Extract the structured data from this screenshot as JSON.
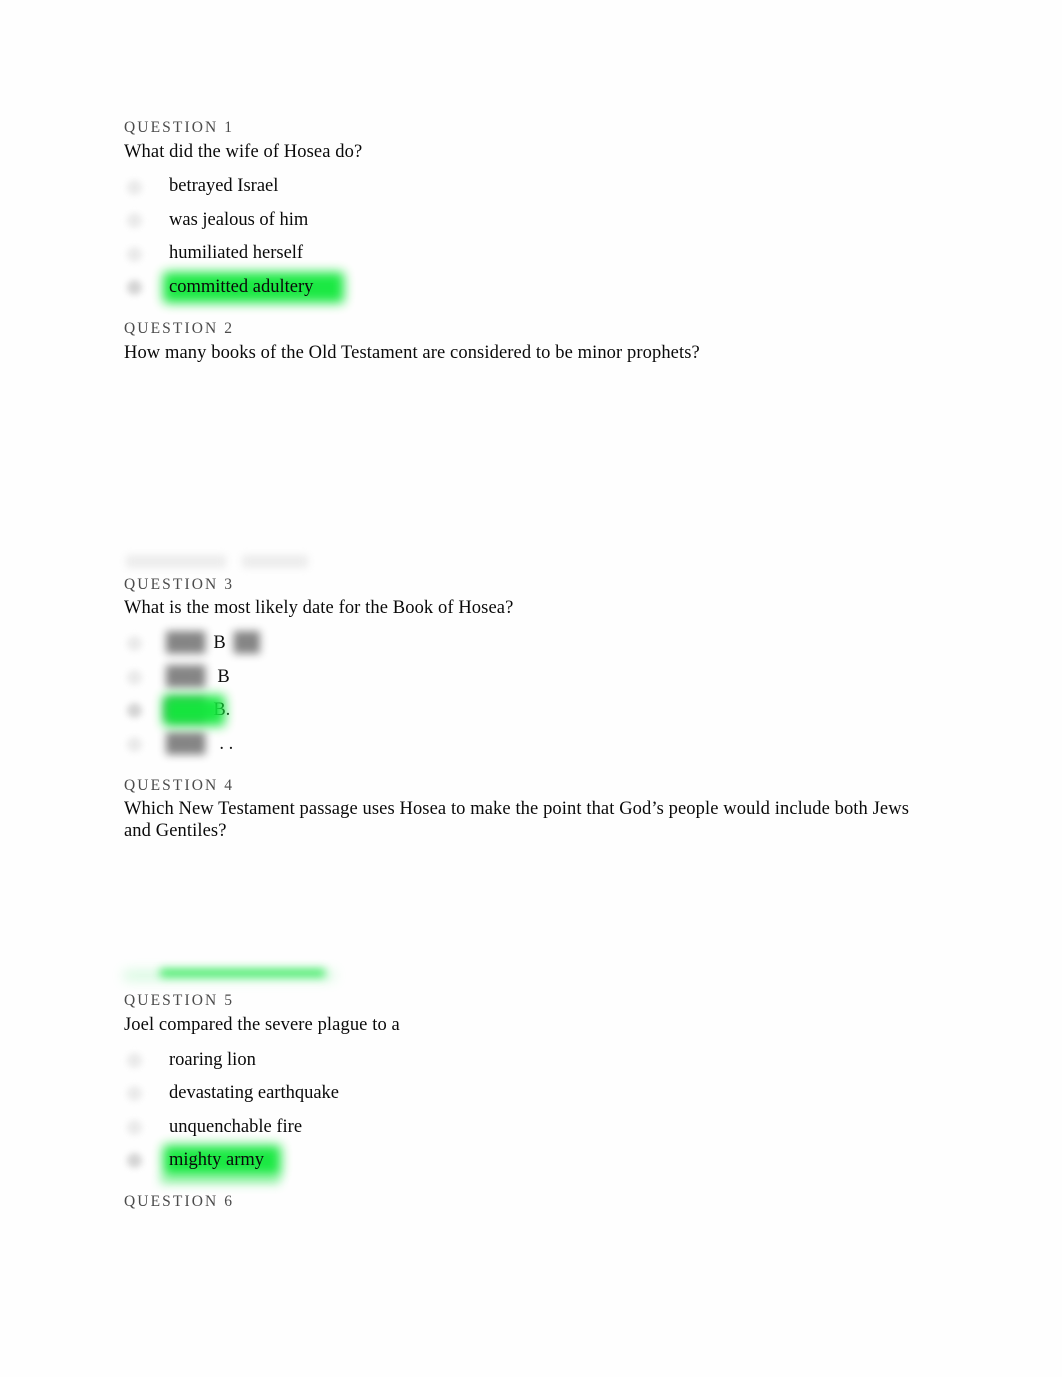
{
  "document": {
    "type": "quiz",
    "highlight_color": "#12e83c",
    "heading_color": "#4b4b4b",
    "text_color": "#0a0a0a",
    "background": "#ffffff"
  },
  "questions": [
    {
      "heading": "QUESTION 1",
      "prompt": "What did the wife of Hosea do?",
      "options": [
        {
          "label": "betrayed Israel",
          "selected": false,
          "highlighted": false,
          "blurred": false
        },
        {
          "label": "was jealous of him",
          "selected": false,
          "highlighted": false,
          "blurred": false
        },
        {
          "label": "humiliated herself",
          "selected": false,
          "highlighted": false,
          "blurred": false
        },
        {
          "label": "committed adultery",
          "selected": true,
          "highlighted": true,
          "blurred": false,
          "highlight_width": 181
        }
      ]
    },
    {
      "heading": "QUESTION 2",
      "prompt": "How many books of the Old Testament are considered to be minor prophets?",
      "options": [],
      "response_area_blank": true
    },
    {
      "heading": "QUESTION 3",
      "prompt": "What is the most likely date for the Book of Hosea?",
      "options": [
        {
          "label": "B",
          "blurred_prefix": "███",
          "blurred_suffix": "██",
          "selected": false,
          "highlighted": false,
          "blurred": true
        },
        {
          "label": "B",
          "blurred_prefix": "███",
          "blurred_suffix": "",
          "selected": false,
          "highlighted": false,
          "blurred": true
        },
        {
          "label": "B.",
          "blurred_prefix": "███",
          "blurred_suffix": "",
          "selected": true,
          "highlighted": true,
          "blurred": true,
          "highlight_width": 62
        },
        {
          "label": ". .",
          "blurred_prefix": "███",
          "blurred_suffix": "",
          "selected": false,
          "highlighted": false,
          "blurred": true
        }
      ]
    },
    {
      "heading": "QUESTION 4",
      "prompt": "Which New Testament passage uses Hosea to make the point that God’s people would include both Jews and Gentiles?",
      "options": [],
      "response_area_blank": true,
      "has_green_remnant": true
    },
    {
      "heading": "QUESTION 5",
      "prompt": "Joel compared the severe plague to a",
      "options": [
        {
          "label": "roaring lion",
          "selected": false,
          "highlighted": false,
          "blurred": false
        },
        {
          "label": "devastating earthquake",
          "selected": false,
          "highlighted": false,
          "blurred": false
        },
        {
          "label": "unquenchable fire",
          "selected": false,
          "highlighted": false,
          "blurred": false
        },
        {
          "label": "mighty army",
          "selected": true,
          "highlighted": true,
          "blurred": false,
          "highlight_width": 118
        }
      ]
    },
    {
      "heading": "QUESTION 6",
      "prompt": "",
      "options": []
    }
  ]
}
